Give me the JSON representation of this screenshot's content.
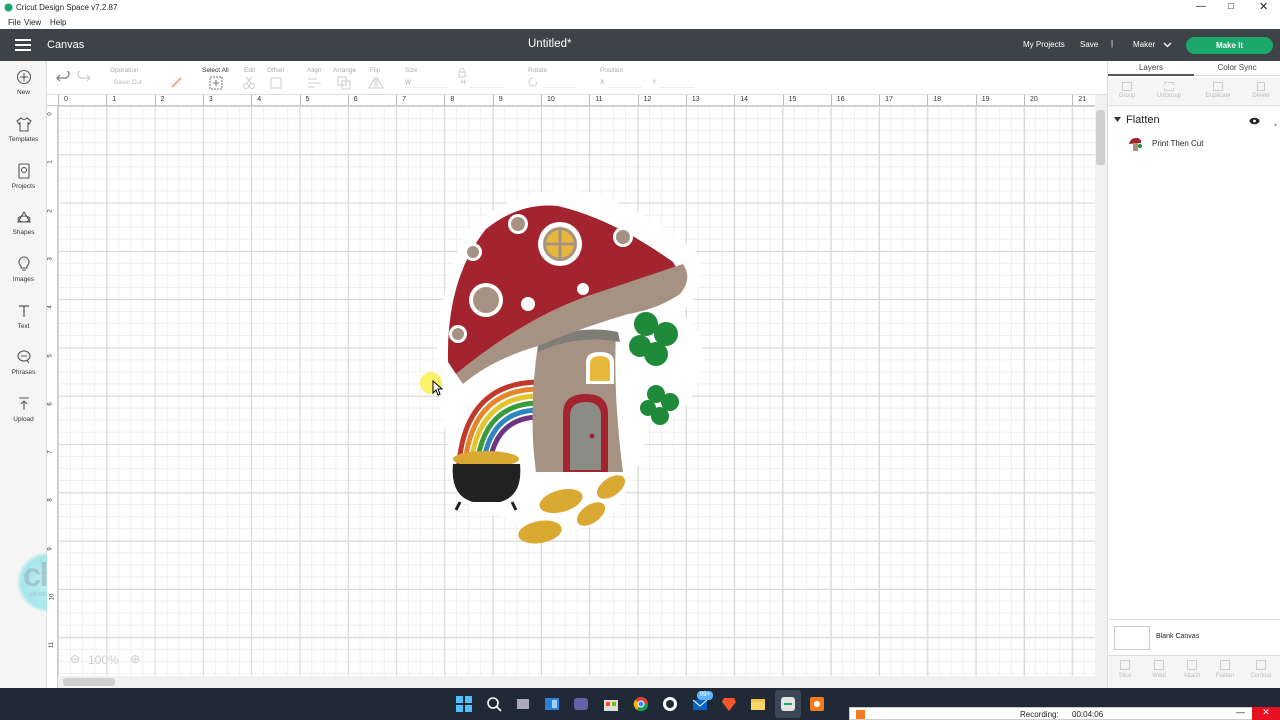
{
  "window": {
    "title": "Cricut Design Space  v7.2.87"
  },
  "menu": [
    "File",
    "View",
    "Help"
  ],
  "header": {
    "section": "Canvas",
    "doc_title": "Untitled*",
    "my_projects": "My Projects",
    "save": "Save",
    "separator": "|",
    "machine": "Maker",
    "make_it": "Make It"
  },
  "toolbar": {
    "operation_label": "Operation",
    "operation_value": "Basic Cut",
    "select_all": "Select All",
    "edit": "Edit",
    "offset": "Offset",
    "align": "Align",
    "arrange": "Arrange",
    "flip": "Flip",
    "size": "Size",
    "size_w": "W",
    "size_h": "H",
    "rotate": "Rotate",
    "position": "Position",
    "pos_x": "X",
    "pos_y": "Y"
  },
  "sidebar": [
    {
      "label": "New",
      "icon": "plus-circle-icon"
    },
    {
      "label": "Templates",
      "icon": "shirt-icon"
    },
    {
      "label": "Projects",
      "icon": "projects-icon"
    },
    {
      "label": "Shapes",
      "icon": "shapes-icon"
    },
    {
      "label": "Images",
      "icon": "bulb-icon"
    },
    {
      "label": "Text",
      "icon": "text-icon"
    },
    {
      "label": "Phrases",
      "icon": "speech-bubble-icon"
    },
    {
      "label": "Upload",
      "icon": "upload-icon"
    }
  ],
  "ruler_top": [
    "0",
    "1",
    "2",
    "3",
    "4",
    "5",
    "6",
    "7",
    "8",
    "9",
    "10",
    "11",
    "12",
    "13",
    "14",
    "15",
    "16",
    "17",
    "18",
    "19",
    "20",
    "21"
  ],
  "ruler_left": [
    "0",
    "1",
    "2",
    "3",
    "4",
    "5",
    "6",
    "7",
    "8",
    "9",
    "10",
    "11"
  ],
  "zoom": "100%",
  "watermark": "cb",
  "watermark_sub": "DESIGNS",
  "panel": {
    "tabs": [
      "Layers",
      "Color Sync"
    ],
    "actions": [
      "Group",
      "UnGroup",
      "Duplicate",
      "Delete"
    ],
    "group_name": "Flatten",
    "layer_name": "Print Then Cut",
    "blank_canvas": "Blank Canvas",
    "bottom_actions": [
      "Slice",
      "Weld",
      "Attach",
      "Flatten",
      "Contour"
    ]
  },
  "recording": {
    "label": "Recording:",
    "time": "00:04:06"
  },
  "colors": {
    "header_bg": "#3e4347",
    "make_it": "#1aa86b",
    "cap_red": "#a3232f",
    "stem_tan": "#a69282",
    "clover_green": "#1f8a3a",
    "gold": "#d9a932"
  }
}
